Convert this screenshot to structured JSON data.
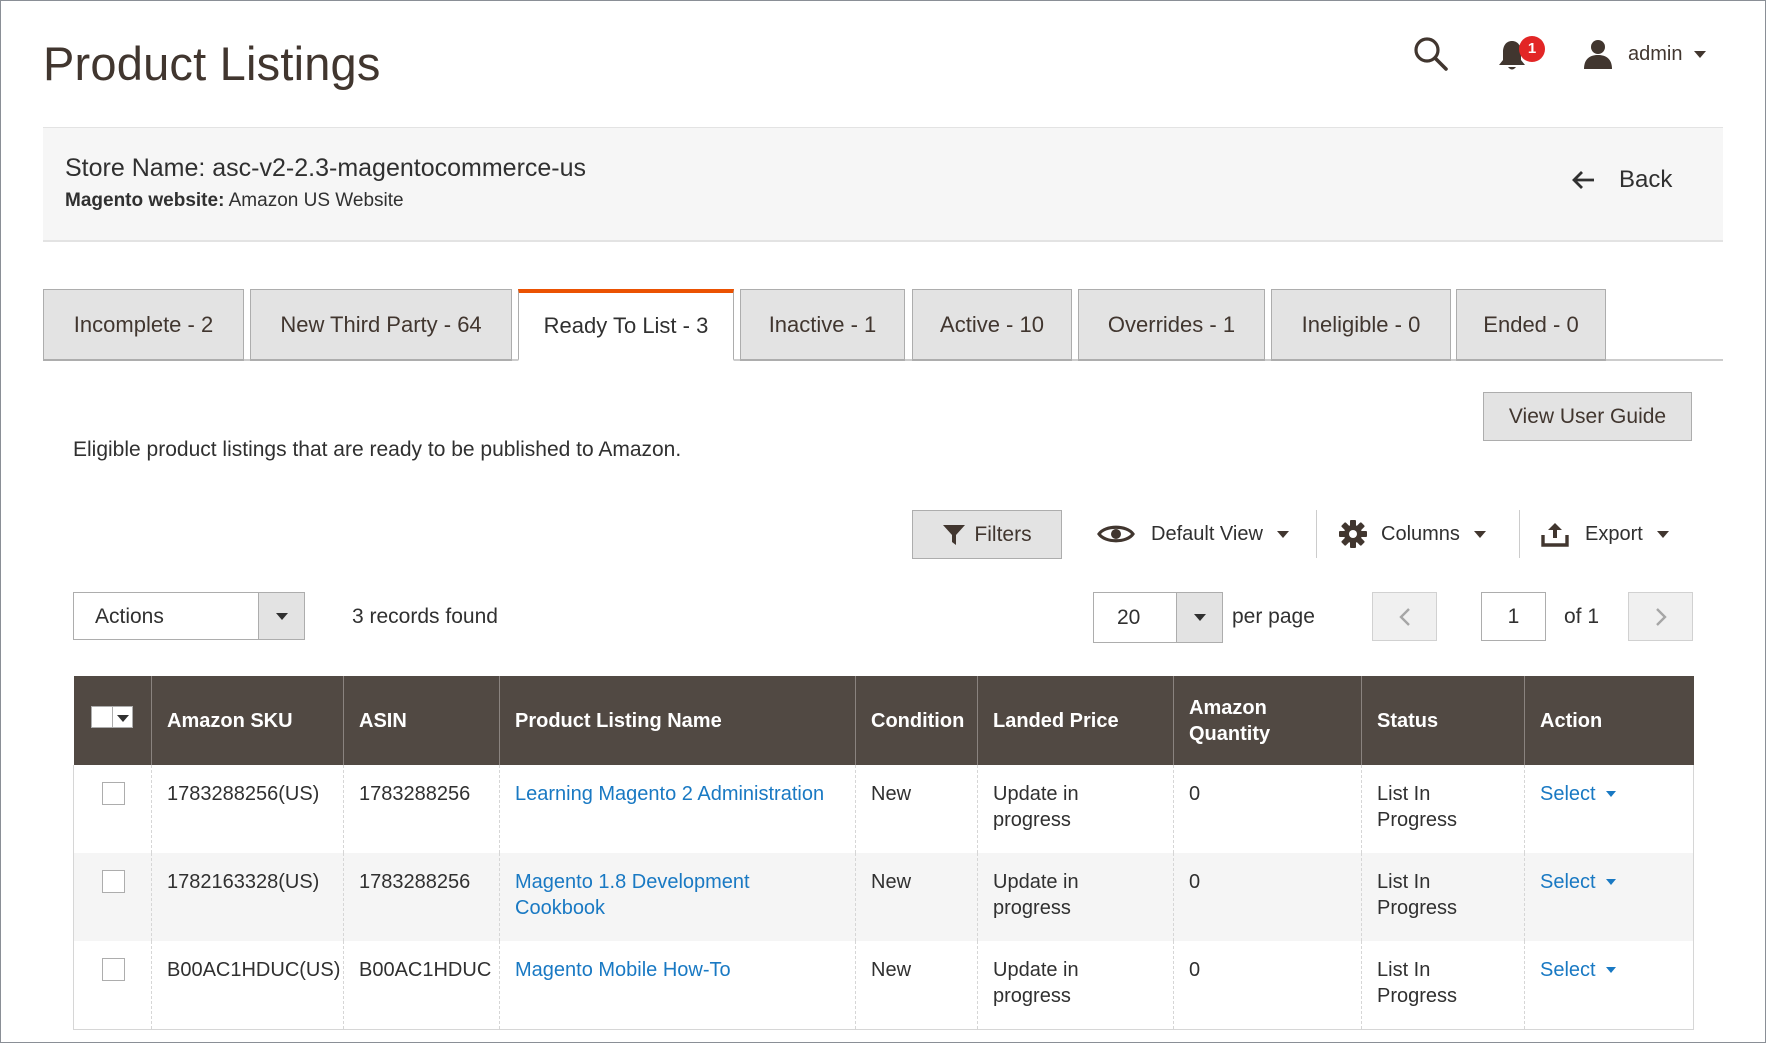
{
  "header": {
    "title": "Product Listings",
    "notification_count": "1",
    "user_name": "admin"
  },
  "store": {
    "name_label": "Store Name: asc-v2-2.3-magentocommerce-us",
    "website_label": "Magento website:",
    "website_value": " Amazon US Website",
    "back_label": "Back"
  },
  "tabs": [
    {
      "label": "Incomplete - 2"
    },
    {
      "label": "New Third Party - 64"
    },
    {
      "label": "Ready To List - 3"
    },
    {
      "label": "Inactive - 1"
    },
    {
      "label": "Active - 10"
    },
    {
      "label": "Overrides - 1"
    },
    {
      "label": "Ineligible - 0"
    },
    {
      "label": "Ended - 0"
    }
  ],
  "active_tab_index": 2,
  "guide_button": "View User Guide",
  "description": "Eligible product listings that are ready to be published to Amazon.",
  "toolbar": {
    "filters_label": "Filters",
    "view_label": "Default View",
    "columns_label": "Columns",
    "export_label": "Export"
  },
  "actions": {
    "label": "Actions",
    "records_found": "3 records found"
  },
  "pagination": {
    "per_page_value": "20",
    "per_page_label": "per page",
    "current_page": "1",
    "total_label": "of 1"
  },
  "grid": {
    "columns": [
      "Amazon SKU",
      "ASIN",
      "Product Listing Name",
      "Condition",
      "Landed Price",
      "Amazon Quantity",
      "Status",
      "Action"
    ],
    "rows": [
      {
        "sku": "1783288256(US)",
        "asin": "1783288256",
        "name": "Learning Magento 2 Administration",
        "condition": "New",
        "price": "Update in progress",
        "qty": "0",
        "status": "List In Progress",
        "action": "Select"
      },
      {
        "sku": "1782163328(US)",
        "asin": "1783288256",
        "name": "Magento 1.8 Development Cookbook",
        "condition": "New",
        "price": "Update in progress",
        "qty": "0",
        "status": "List In Progress",
        "action": "Select"
      },
      {
        "sku": "B00AC1HDUC(US)",
        "asin": "B00AC1HDUC",
        "name": "Magento Mobile How-To",
        "condition": "New",
        "price": "Update in progress",
        "qty": "0",
        "status": "List In Progress",
        "action": "Select"
      }
    ]
  },
  "colors": {
    "accent": "#eb5202",
    "link": "#1979c3",
    "grid_header": "#514943",
    "badge": "#e22626"
  }
}
